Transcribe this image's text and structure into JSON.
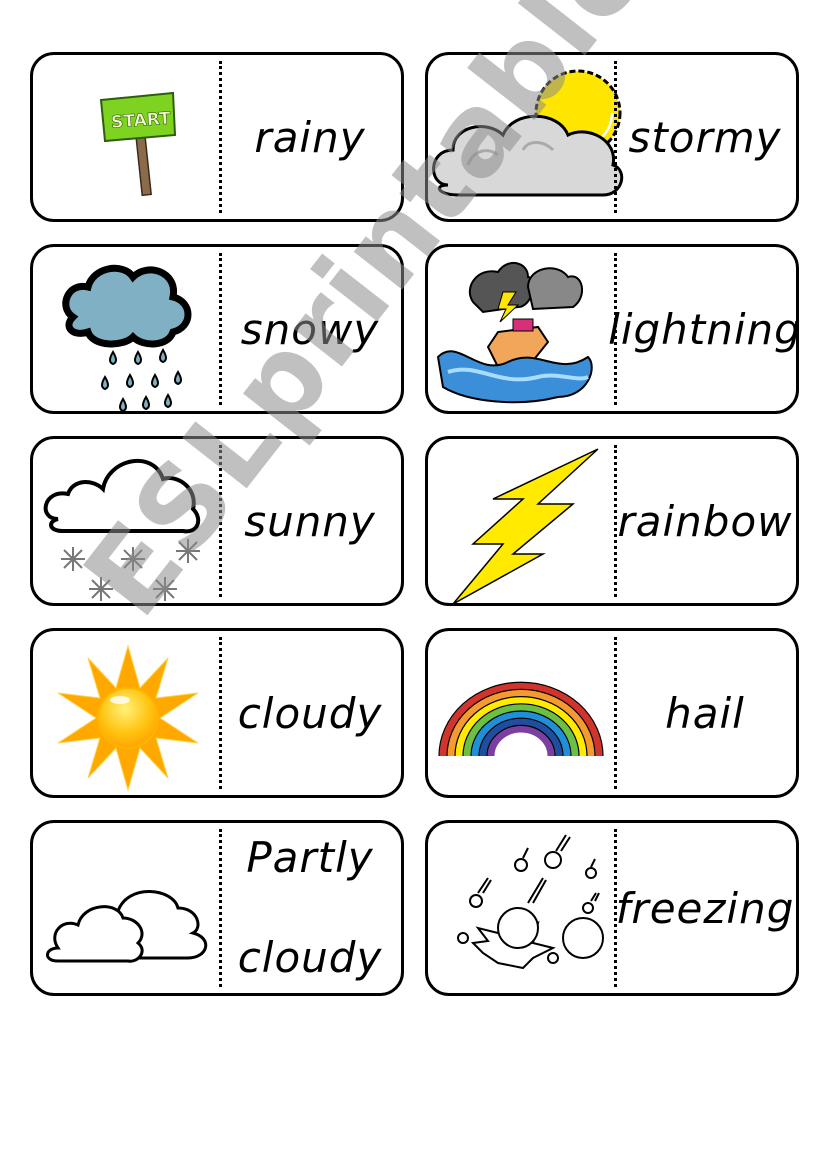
{
  "worksheet": {
    "watermark": "ESLprintables.com",
    "cards": [
      {
        "picture": "start-sign",
        "word": "rainy"
      },
      {
        "picture": "partly-cloudy-sun",
        "word": "stormy"
      },
      {
        "picture": "rain-cloud",
        "word": "snowy"
      },
      {
        "picture": "storm-boat",
        "word": "lightning"
      },
      {
        "picture": "snow-cloud",
        "word": "sunny"
      },
      {
        "picture": "lightning-bolt",
        "word": "rainbow"
      },
      {
        "picture": "sun",
        "word": "cloudy"
      },
      {
        "picture": "rainbow",
        "word": "hail"
      },
      {
        "picture": "clouds",
        "word_line1": "Partly",
        "word_line2": "cloudy"
      },
      {
        "picture": "hailstones",
        "word": "freezing"
      }
    ],
    "start_sign_text": "START"
  },
  "colors": {
    "border": "#000000",
    "sign_green": "#7ED321",
    "sun_yellow": "#FFE600",
    "sun_orange": "#FF9E00",
    "rain_blue": "#7FB0C4",
    "cloud_grey": "#D8D8D8",
    "storm_dark": "#555555",
    "wave_blue": "#3A8FD8",
    "rainbow": [
      "#D0342C",
      "#F59A2F",
      "#FFEA00",
      "#6CBF45",
      "#1E8FD8",
      "#1F4EA0",
      "#7A3FA0"
    ]
  }
}
